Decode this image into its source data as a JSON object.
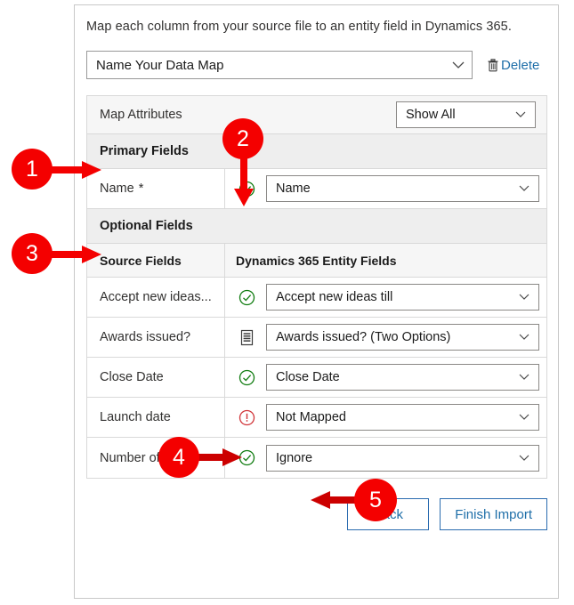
{
  "dialog": {
    "intro": "Map each column from your source file to an entity field in Dynamics 365.",
    "map_name": {
      "value": "Name Your Data Map",
      "chevron_icon": "chevron-down-icon"
    },
    "delete": {
      "label": "Delete",
      "icon": "trash-icon"
    }
  },
  "grid": {
    "map_attributes": {
      "title": "Map Attributes",
      "filter_value": "Show All",
      "filter_options": [
        "Show All"
      ]
    },
    "primary_section": {
      "label": "Primary Fields"
    },
    "primary_rows": [
      {
        "source": "Name",
        "required": true,
        "required_marker": "*",
        "status": "mapped",
        "status_icon": "check-circle-icon",
        "target": "Name"
      }
    ],
    "optional_section": {
      "label": "Optional Fields"
    },
    "columns": {
      "source": "Source Fields",
      "target": "Dynamics 365 Entity Fields"
    },
    "optional_rows": [
      {
        "source": "Accept new ideas...",
        "required": false,
        "status": "mapped",
        "status_icon": "check-circle-icon",
        "target": "Accept new ideas till"
      },
      {
        "source": "Awards issued?",
        "required": false,
        "status": "option-set",
        "status_icon": "list-options-icon",
        "target": "Awards issued? (Two Options)"
      },
      {
        "source": "Close Date",
        "required": false,
        "status": "mapped",
        "status_icon": "check-circle-icon",
        "target": "Close Date"
      },
      {
        "source": "Launch date",
        "required": false,
        "status": "not-mapped",
        "status_icon": "error-circle-icon",
        "target": "Not Mapped"
      },
      {
        "source": "Number of ideas",
        "required": false,
        "status": "mapped",
        "status_icon": "check-circle-icon",
        "target": "Ignore"
      }
    ]
  },
  "footer": {
    "back_label": "Back",
    "finish_label": "Finish Import"
  },
  "annotations": [
    {
      "number": "1",
      "target": "primary-fields-section"
    },
    {
      "number": "2",
      "target": "name-row-status-icon"
    },
    {
      "number": "3",
      "target": "optional-fields-section"
    },
    {
      "number": "4",
      "target": "launch-date-error-icon"
    },
    {
      "number": "5",
      "target": "number-of-ideas-target-value"
    }
  ],
  "colors": {
    "callout_red": "#f40000",
    "success_green": "#107c10",
    "error_red": "#d13438",
    "link_blue": "#1e6ea8",
    "button_border": "#2b6cb0"
  }
}
